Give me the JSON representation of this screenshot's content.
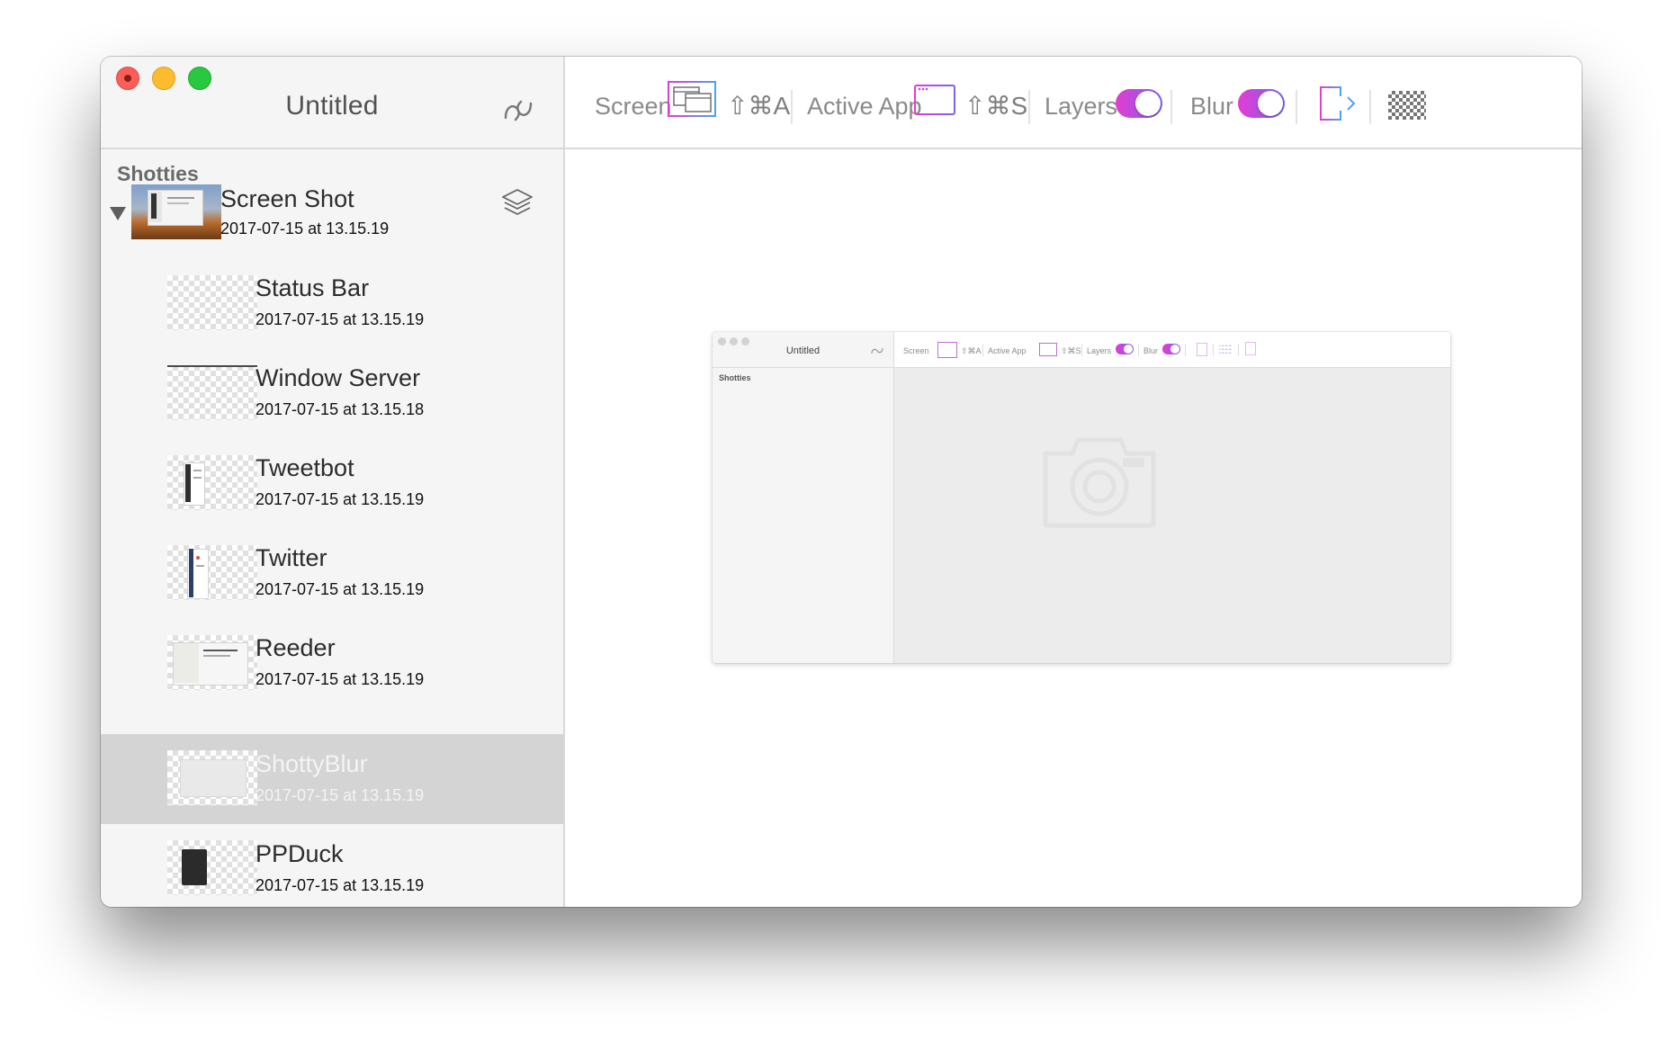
{
  "window": {
    "title": "Untitled",
    "controls": [
      "close",
      "minimize",
      "zoom"
    ]
  },
  "sidebar": {
    "section_title": "Shotties",
    "parent": {
      "title": "Screen Shot",
      "date": "2017-07-15 at 13.15.19",
      "expanded": true
    },
    "items": [
      {
        "title": "Status Bar",
        "date": "2017-07-15 at 13.15.19",
        "selected": false
      },
      {
        "title": "Window Server",
        "date": "2017-07-15 at 13.15.18",
        "selected": false
      },
      {
        "title": "Tweetbot",
        "date": "2017-07-15 at 13.15.19",
        "selected": false
      },
      {
        "title": "Twitter",
        "date": "2017-07-15 at 13.15.19",
        "selected": false
      },
      {
        "title": "Reeder",
        "date": "2017-07-15 at 13.15.19",
        "selected": false
      },
      {
        "title": "ShottyBlur",
        "date": "2017-07-15 at 13.15.19",
        "selected": true
      },
      {
        "title": "PPDuck",
        "date": "2017-07-15 at 13.15.19",
        "selected": false
      }
    ]
  },
  "toolbar": {
    "screen_label": "Screen",
    "screen_shortcut": "⇧⌘A",
    "active_app_label": "Active App",
    "active_app_shortcut": "⇧⌘S",
    "layers_label": "Layers",
    "layers_on": true,
    "blur_label": "Blur",
    "blur_on": true,
    "icons": [
      "screen-capture-icon",
      "active-app-capture-icon",
      "export-icon",
      "checkerboard-icon"
    ]
  },
  "preview": {
    "window_title": "Untitled",
    "section_title": "Shotties",
    "screen_label": "Screen",
    "screen_shortcut": "⇧⌘A",
    "active_app_label": "Active App",
    "active_app_shortcut": "⇧⌘S",
    "layers_label": "Layers",
    "blur_label": "Blur"
  },
  "colors": {
    "accent_pink": "#e53bd0",
    "accent_purple": "#7a63f2",
    "accent_blue": "#4aa3f0",
    "selection": "#d4d4d4"
  }
}
